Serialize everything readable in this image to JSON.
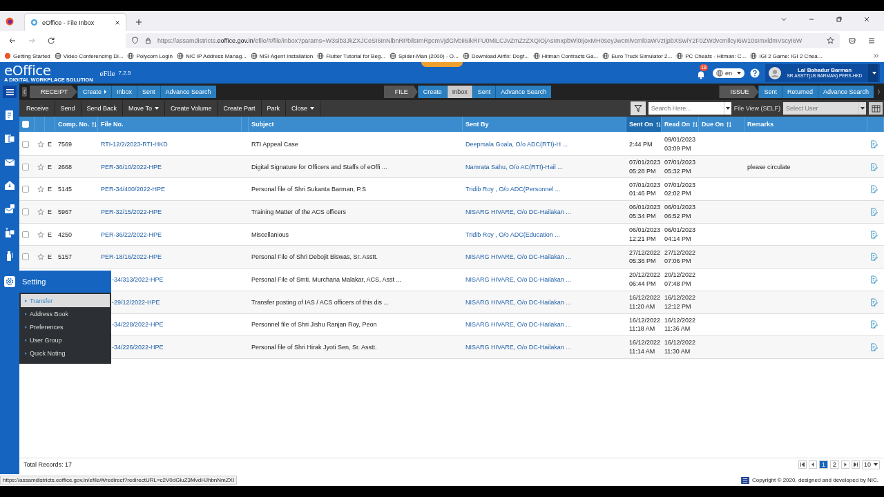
{
  "browser": {
    "tabs": [
      {
        "title": "eOffice - File Inbox",
        "selected": true
      }
    ],
    "url": {
      "host_before": "https://assamdistricts.",
      "host": "eoffice.gov.in",
      "path": "/efile/#/file/inbox?params=W3sib3JkZXJCeSI6InNlbnRPbilsImRpcmVjdGlvbiI6IkRFU0MiLCJvZmZzZXQiOjAsImxpbWl0IjoxMH0seyJwcmlvcml0aWVzIjpbXSwiY2F0ZWdvcmllcyI6W10sImxldmVscyI6W"
    },
    "bookmarks": [
      "Getting Started",
      "Video Conferencing Di...",
      "Polycom Login",
      "NIC IP Address Manag...",
      "MSI Agent Installation",
      "Flutter Tutorial for Beg...",
      "Spider-Man (2000) - O...",
      "Download Airfix: Dogf...",
      "Hitman Contracts Ga...",
      "Euro Truck Simulator 2...",
      "PC Cheats - Hitman: C...",
      "IGI 2 Game: IGI 2 Chea..."
    ]
  },
  "header": {
    "logo": "eOffice",
    "tagline": "A DIGITAL WORKPLACE SOLUTION",
    "app": "eFile",
    "version": "7.2.5",
    "notifications": "18",
    "language": "en",
    "user": {
      "name": "Lal Bahadur Barman",
      "role": "SR.ASSTT(LB BARMAN) PERS-HKD"
    }
  },
  "nav": [
    {
      "label": "RECEIPT",
      "items": [
        {
          "label": "Create",
          "selected": false,
          "submenu": true
        },
        {
          "label": "Inbox",
          "selected": false,
          "submenu": false
        },
        {
          "label": "Sent",
          "selected": false,
          "submenu": false
        },
        {
          "label": "Advance Search",
          "selected": false,
          "submenu": false
        }
      ]
    },
    {
      "label": "FILE",
      "items": [
        {
          "label": "Create",
          "selected": false,
          "submenu": false
        },
        {
          "label": "Inbox",
          "selected": true,
          "submenu": false
        },
        {
          "label": "Sent",
          "selected": false,
          "submenu": false
        },
        {
          "label": "Advance Search",
          "selected": false,
          "submenu": false
        }
      ]
    },
    {
      "label": "ISSUE",
      "items": [
        {
          "label": "Sent",
          "selected": false,
          "submenu": false
        },
        {
          "label": "Returned",
          "selected": false,
          "submenu": false
        },
        {
          "label": "Advance Search",
          "selected": false,
          "submenu": false
        }
      ]
    }
  ],
  "toolbar": [
    {
      "label": "Receive",
      "dropdown": false
    },
    {
      "label": "Send",
      "dropdown": false
    },
    {
      "label": "Send Back",
      "dropdown": false
    },
    {
      "label": "Move To",
      "dropdown": true
    },
    {
      "label": "Create Volume",
      "dropdown": false
    },
    {
      "label": "Create Part",
      "dropdown": false
    },
    {
      "label": "Park",
      "dropdown": false
    },
    {
      "label": "Close",
      "dropdown": true
    }
  ],
  "search": {
    "placeholder": "Search Here..."
  },
  "file_view": {
    "label": "File View (SELF)",
    "placeholder": "Select User"
  },
  "table": {
    "select_all": false,
    "columns": [
      {
        "label": "Comp. No.",
        "sortable": true,
        "sorted": false
      },
      {
        "label": "File No.",
        "sortable": false,
        "sorted": false
      },
      {
        "label": "Subject",
        "sortable": false,
        "sorted": false
      },
      {
        "label": "Sent By",
        "sortable": false,
        "sorted": false
      },
      {
        "label": "Sent On",
        "sortable": true,
        "sorted": true
      },
      {
        "label": "Read On",
        "sortable": true,
        "sorted": false
      },
      {
        "label": "Due On",
        "sortable": true,
        "sorted": false
      },
      {
        "label": "Remarks",
        "sortable": false,
        "sorted": false
      }
    ],
    "rows": [
      {
        "checked": false,
        "type": "E",
        "comp_no": "7569",
        "file_no": "RTI-12/2/2023-RTI-HKD",
        "subject": "RTI Appeal Case",
        "sent_by": "Deepmala Goala, O/o ADC(RTI)-H ...",
        "sent_on": [
          "2:44 PM"
        ],
        "read_on": [
          "09/01/2023",
          "03:09 PM"
        ]
      },
      {
        "checked": false,
        "type": "E",
        "comp_no": "2668",
        "file_no": "PER-36/10/2022-HPE",
        "subject": "Digital Signature for Officers and Staffs of eOffi ...",
        "sent_by": "Namrata Sahu, O/o AC(RTI)-Hail ...",
        "sent_on": [
          "07/01/2023",
          "05:28 PM"
        ],
        "read_on": [
          "07/01/2023",
          "05:32 PM"
        ],
        "remarks": "please circulate"
      },
      {
        "checked": false,
        "type": "E",
        "comp_no": "5145",
        "file_no": "PER-34/400/2022-HPE",
        "subject": "Personal file of Shri Sukanta Barman, P.S",
        "sent_by": "Tridib Roy , O/o ADC(Personnel ...",
        "sent_on": [
          "07/01/2023",
          "01:46 PM"
        ],
        "read_on": [
          "07/01/2023",
          "02:02 PM"
        ]
      },
      {
        "checked": false,
        "type": "E",
        "comp_no": "5967",
        "file_no": "PER-32/15/2022-HPE",
        "subject": "Training Matter of the ACS officers",
        "sent_by": "NISARG HIVARE, O/o DC-Hailakan ...",
        "sent_on": [
          "06/01/2023",
          "05:34 PM"
        ],
        "read_on": [
          "06/01/2023",
          "06:52 PM"
        ]
      },
      {
        "checked": false,
        "type": "E",
        "comp_no": "4250",
        "file_no": "PER-36/22/2022-HPE",
        "subject": "Miscellanious",
        "sent_by": "Tridib Roy , O/o ADC(Education ...",
        "sent_on": [
          "06/01/2023",
          "12:21 PM"
        ],
        "read_on": [
          "06/01/2023",
          "04:14 PM"
        ]
      },
      {
        "checked": false,
        "type": "E",
        "comp_no": "5157",
        "file_no": "PER-18/16/2022-HPE",
        "subject": "Personal File of Shri Debojit Biswas, Sr. Asstt.",
        "sent_by": "NISARG HIVARE, O/o DC-Hailakan ...",
        "sent_on": [
          "27/12/2022",
          "05:36 PM"
        ],
        "read_on": [
          "27/12/2022",
          "07:06 PM"
        ]
      },
      {
        "file_no": "-34/313/2022-HPE",
        "subject": "Personal File of Smti. Murchana Malakar, ACS, Asst ...",
        "sent_by": "NISARG HIVARE, O/o DC-Hailakan ...",
        "sent_on": [
          "20/12/2022",
          "06:44 PM"
        ],
        "read_on": [
          "20/12/2022",
          "07:48 PM"
        ]
      },
      {
        "file_no": "-29/12/2022-HPE",
        "subject": "Transfer posting of IAS / ACS officers of this dis ...",
        "sent_by": "NISARG HIVARE, O/o DC-Hailakan ...",
        "sent_on": [
          "16/12/2022",
          "11:20 AM"
        ],
        "read_on": [
          "16/12/2022",
          "12:12 PM"
        ]
      },
      {
        "file_no": "-34/228/2022-HPE",
        "subject": "Personnel file of Shri Jishu Ranjan Roy, Peon",
        "sent_by": "NISARG HIVARE, O/o DC-Hailakan ...",
        "sent_on": [
          "16/12/2022",
          "11:18 AM"
        ],
        "read_on": [
          "16/12/2022",
          "11:36 AM"
        ]
      },
      {
        "file_no": "-34/226/2022-HPE",
        "subject": "Personal file of Shri Hirak Jyoti Sen, Sr. Asstt.",
        "sent_by": "NISARG HIVARE, O/o DC-Hailakan ...",
        "sent_on": [
          "16/12/2022",
          "11:14 AM"
        ],
        "read_on": [
          "16/12/2022",
          "11:30 AM"
        ]
      }
    ]
  },
  "settings_menu": {
    "title": "Setting",
    "items": [
      {
        "label": "Transfer",
        "selected": true
      },
      {
        "label": "Address Book",
        "selected": false
      },
      {
        "label": "Preferences",
        "selected": false
      },
      {
        "label": "User Group",
        "selected": false
      },
      {
        "label": "Quick Noting",
        "selected": false
      }
    ]
  },
  "footer": {
    "total": "Total Records: 17",
    "pages": [
      {
        "label": "1",
        "selected": true
      },
      {
        "label": "2",
        "selected": false
      }
    ],
    "page_size": "10",
    "copyright": "Copyright © 2020, designed and developed by NIC."
  },
  "status_url": "https://assamdistricts.eoffice.gov.in/efile/#/redirect?redirectURL=c2V0dGluZ3MvdHJhbnNmZXI"
}
